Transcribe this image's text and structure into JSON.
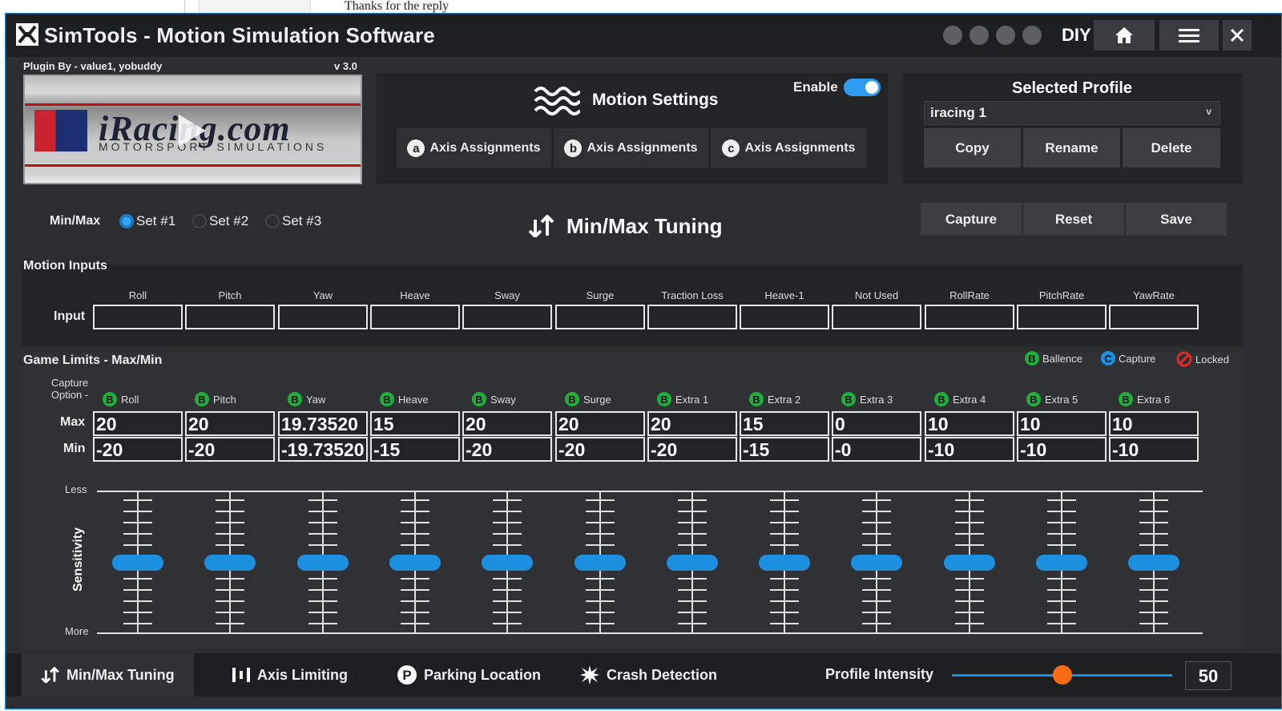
{
  "background_page": {
    "text": "Thanks for the reply"
  },
  "app": {
    "title": "SimTools - Motion Simulation Software",
    "diy_label": "DIY",
    "accent_color": "#1c8fe0"
  },
  "plugin": {
    "by": "Plugin By - value1, yobuddy",
    "version": "v 3.0",
    "banner_brand": "iRacing.com",
    "banner_sub": "MOTORSPORT SIMULATIONS"
  },
  "motion_settings": {
    "title": "Motion Settings",
    "enable_label": "Enable",
    "enabled": true,
    "axis_buttons": [
      {
        "letter": "a",
        "label": "Axis Assignments"
      },
      {
        "letter": "b",
        "label": "Axis Assignments"
      },
      {
        "letter": "c",
        "label": "Axis Assignments"
      }
    ]
  },
  "selected_profile": {
    "title": "Selected Profile",
    "value": "iracing 1",
    "chevron": "v",
    "buttons": [
      "Copy",
      "Rename",
      "Delete"
    ]
  },
  "minmax": {
    "label": "Min/Max",
    "sets": [
      {
        "label": "Set #1",
        "selected": true
      },
      {
        "label": "Set #2",
        "selected": false
      },
      {
        "label": "Set #3",
        "selected": false
      }
    ],
    "section_title": "Min/Max Tuning",
    "actions": [
      "Capture",
      "Reset",
      "Save"
    ]
  },
  "motion_inputs": {
    "title": "Motion Inputs",
    "row_label": "Input",
    "columns": [
      "Roll",
      "Pitch",
      "Yaw",
      "Heave",
      "Sway",
      "Surge",
      "Traction Loss",
      "Heave-1",
      "Not Used",
      "RollRate",
      "PitchRate",
      "YawRate"
    ]
  },
  "game_limits": {
    "title": "Game Limits - Max/Min",
    "legend": [
      {
        "badge": "B",
        "label": "Ballence",
        "color": "#1fae3a"
      },
      {
        "badge": "C",
        "label": "Capture",
        "color": "#1c8fe0"
      },
      {
        "badge": "",
        "label": "Locked",
        "color": "#e02a2a"
      }
    ],
    "capture_option_label": "Capture Option -",
    "max_label": "Max",
    "min_label": "Min",
    "columns": [
      {
        "badge": "B",
        "name": "Roll",
        "max": "20",
        "min": "-20"
      },
      {
        "badge": "B",
        "name": "Pitch",
        "max": "20",
        "min": "-20"
      },
      {
        "badge": "B",
        "name": "Yaw",
        "max": "19.73520",
        "min": "-19.73520"
      },
      {
        "badge": "B",
        "name": "Heave",
        "max": "15",
        "min": "-15"
      },
      {
        "badge": "B",
        "name": "Sway",
        "max": "20",
        "min": "-20"
      },
      {
        "badge": "B",
        "name": "Surge",
        "max": "20",
        "min": "-20"
      },
      {
        "badge": "B",
        "name": "Extra 1",
        "max": "20",
        "min": "-20"
      },
      {
        "badge": "B",
        "name": "Extra 2",
        "max": "15",
        "min": "-15"
      },
      {
        "badge": "B",
        "name": "Extra 3",
        "max": "0",
        "min": "-0"
      },
      {
        "badge": "B",
        "name": "Extra 4",
        "max": "10",
        "min": "-10"
      },
      {
        "badge": "B",
        "name": "Extra 5",
        "max": "10",
        "min": "-10"
      },
      {
        "badge": "B",
        "name": "Extra 6",
        "max": "10",
        "min": "-10"
      }
    ],
    "sensitivity": {
      "label": "Sensitivity",
      "less_label": "Less",
      "more_label": "More",
      "levels": [
        0.5,
        0.5,
        0.5,
        0.5,
        0.5,
        0.5,
        0.5,
        0.5,
        0.5,
        0.5,
        0.5,
        0.5
      ]
    }
  },
  "bottom_tabs": [
    {
      "label": "Min/Max Tuning",
      "icon": "updown-arrows-icon",
      "active": true
    },
    {
      "label": "Axis Limiting",
      "icon": "bars-icon",
      "active": false
    },
    {
      "label": "Parking Location",
      "icon": "parking-icon",
      "active": false
    },
    {
      "label": "Crash Detection",
      "icon": "crash-icon",
      "active": false
    }
  ],
  "profile_intensity": {
    "label": "Profile Intensity",
    "value": "50",
    "level": 0.5,
    "knob_color": "#ff6a14"
  }
}
